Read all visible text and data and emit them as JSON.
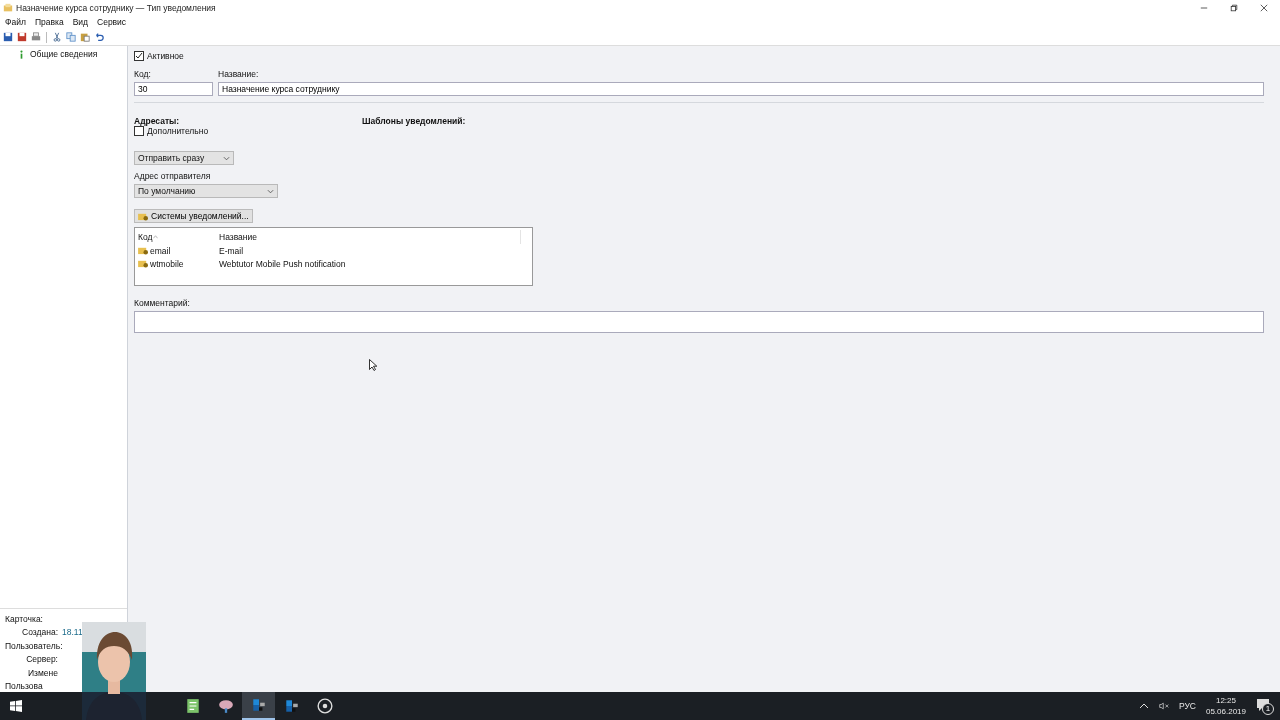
{
  "window": {
    "title": "Назначение курса сотруднику — Тип уведомления"
  },
  "menu": [
    "Файл",
    "Правка",
    "Вид",
    "Сервис"
  ],
  "toolbar": [
    {
      "kind": "save"
    },
    {
      "kind": "save-close"
    },
    {
      "kind": "print"
    },
    {
      "kind": "sep"
    },
    {
      "kind": "cut"
    },
    {
      "kind": "copy"
    },
    {
      "kind": "paste"
    },
    {
      "kind": "undo"
    }
  ],
  "sidebar": {
    "items": [
      {
        "label": "Общие сведения",
        "selected": false
      }
    ],
    "info_title": "Карточка:",
    "info": [
      {
        "label": "Создана:",
        "value": "18.11"
      },
      {
        "label": "Пользователь:"
      },
      {
        "label": "Сервер:"
      },
      {
        "label": "Измене"
      },
      {
        "label": "Пользова"
      }
    ]
  },
  "form": {
    "active": {
      "label": "Активное",
      "checked": true
    },
    "code": {
      "label": "Код:",
      "value": "30"
    },
    "name": {
      "label": "Название:",
      "value": "Назначение курса сотруднику"
    },
    "recipients_title": "Адресаты:",
    "templates_title": "Шаблоны уведомлений:",
    "extra": {
      "label": "Дополнительно",
      "checked": false
    },
    "send_mode": {
      "value": "Отправить сразу"
    },
    "sender_label": "Адрес отправителя",
    "sender": {
      "value": "По умолчанию"
    },
    "systems_button": "Системы уведомлений...",
    "systems_table": {
      "columns": [
        {
          "label": "Код",
          "sorted": true
        },
        {
          "label": "Название",
          "sorted": false
        }
      ],
      "rows": [
        {
          "code": "email",
          "name": "E-mail",
          "selected": false
        },
        {
          "code": "wtmobile",
          "name": "Webtutor Mobile Push notification",
          "selected": false
        }
      ]
    },
    "comment": {
      "label": "Комментарий:"
    }
  },
  "webcam": {
    "kind": "picture"
  },
  "taskbar": {
    "apps": [
      {
        "kind": "editor",
        "selected": false
      },
      {
        "kind": "brain",
        "selected": false
      },
      {
        "kind": "blocks",
        "selected": true
      },
      {
        "kind": "blocks",
        "selected": false
      },
      {
        "kind": "obs",
        "selected": false
      }
    ],
    "language": "РУС",
    "time": "12:25",
    "date": "05.06.2019",
    "notifications": "1"
  }
}
